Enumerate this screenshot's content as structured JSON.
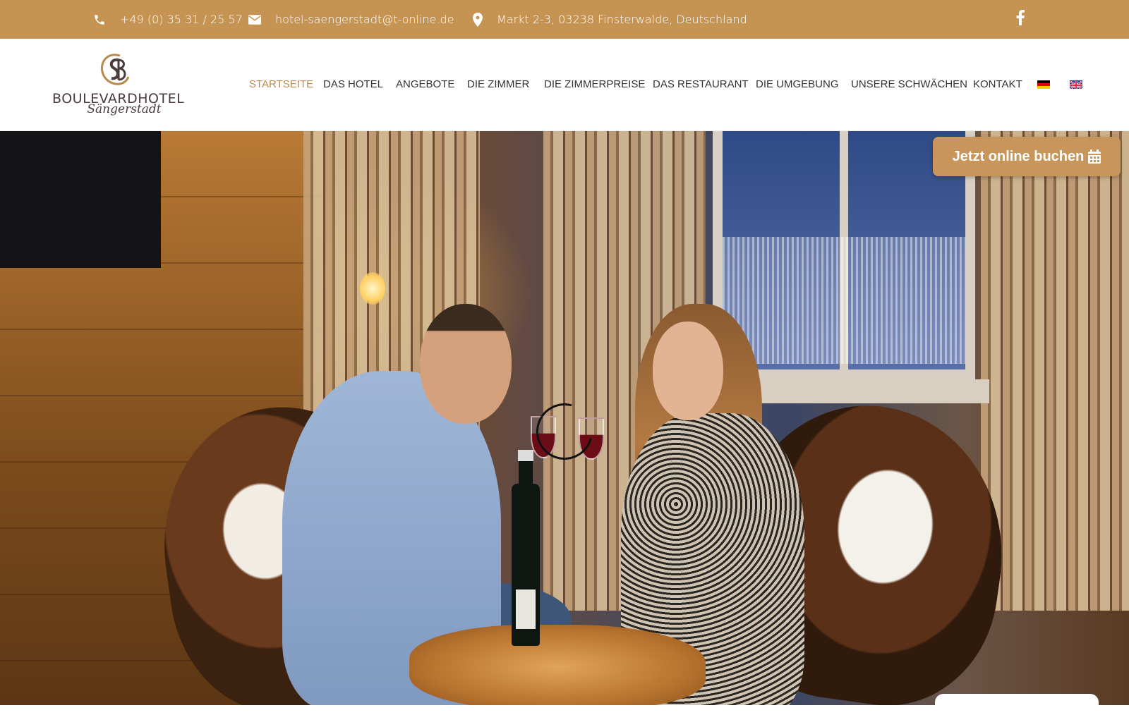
{
  "topbar": {
    "phone": "+49 (0) 35 31 / 25 57",
    "email": "hotel-saengerstadt@t-online.de",
    "address": "Markt 2-3, 03238 Finsterwalde, Deutschland",
    "icons": {
      "phone": "phone-icon",
      "email": "envelope-icon",
      "address": "map-pin-icon",
      "social": "facebook-icon"
    }
  },
  "logo": {
    "monogram": "SB",
    "name": "BOULEVARDHOTEL",
    "script": "Sängerstadt"
  },
  "nav": {
    "items": [
      {
        "label": "STARTSEITE",
        "active": true
      },
      {
        "label": "DAS HOTEL"
      },
      {
        "label": "ANGEBOTE"
      },
      {
        "label": "DIE ZIMMER"
      },
      {
        "label": "DIE ZIMMERPREISE"
      },
      {
        "label": "DAS RESTAURANT"
      },
      {
        "label": "DIE UMGEBUNG"
      },
      {
        "label": "UNSERE SCHWÄCHEN"
      },
      {
        "label": "KONTAKT"
      }
    ],
    "languages": [
      "german-flag-icon",
      "english-flag-icon"
    ]
  },
  "hero": {
    "book_button": "Jetzt online buchen",
    "book_icon": "calendar-icon"
  },
  "colors": {
    "topbar": "#c59453",
    "accent": "#b88a4c",
    "button": "#c8955a",
    "nav_text": "#333333"
  }
}
